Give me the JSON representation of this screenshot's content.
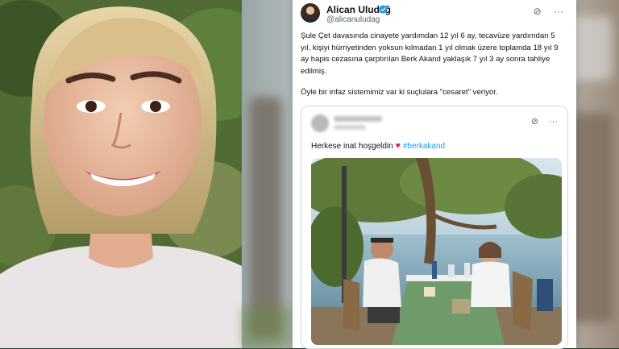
{
  "tweet": {
    "author_name": "Alican Uludağ",
    "author_handle": "@alicanuludag",
    "text_paragraph_1": "Şule Çet davasında cinayete yardımdan 12 yıl 6 ay, tecavüze yardımdan 5 yıl, kişiyi hürriyetinden yoksun kılmadan 1 yıl olmak üzere toplamda 18 yıl 9 ay hapis cezasına çarptırılan Berk Akand yaklaşık 7 yıl 3 ay sonra tahliye edilmiş.",
    "text_paragraph_2": "Öyle bir infaz sistemimiz var ki suçlulara \"cesaret\" veriyor.",
    "icons": [
      "grok-icon",
      "more-icon"
    ]
  },
  "quote": {
    "text": "Herkese inat hoşgeldin",
    "heart": "♥",
    "hashtag": "#berkakand"
  },
  "colors": {
    "accent": "#1d9bf0",
    "heart": "#e0245e",
    "text": "#0f1419",
    "muted": "#536471"
  }
}
